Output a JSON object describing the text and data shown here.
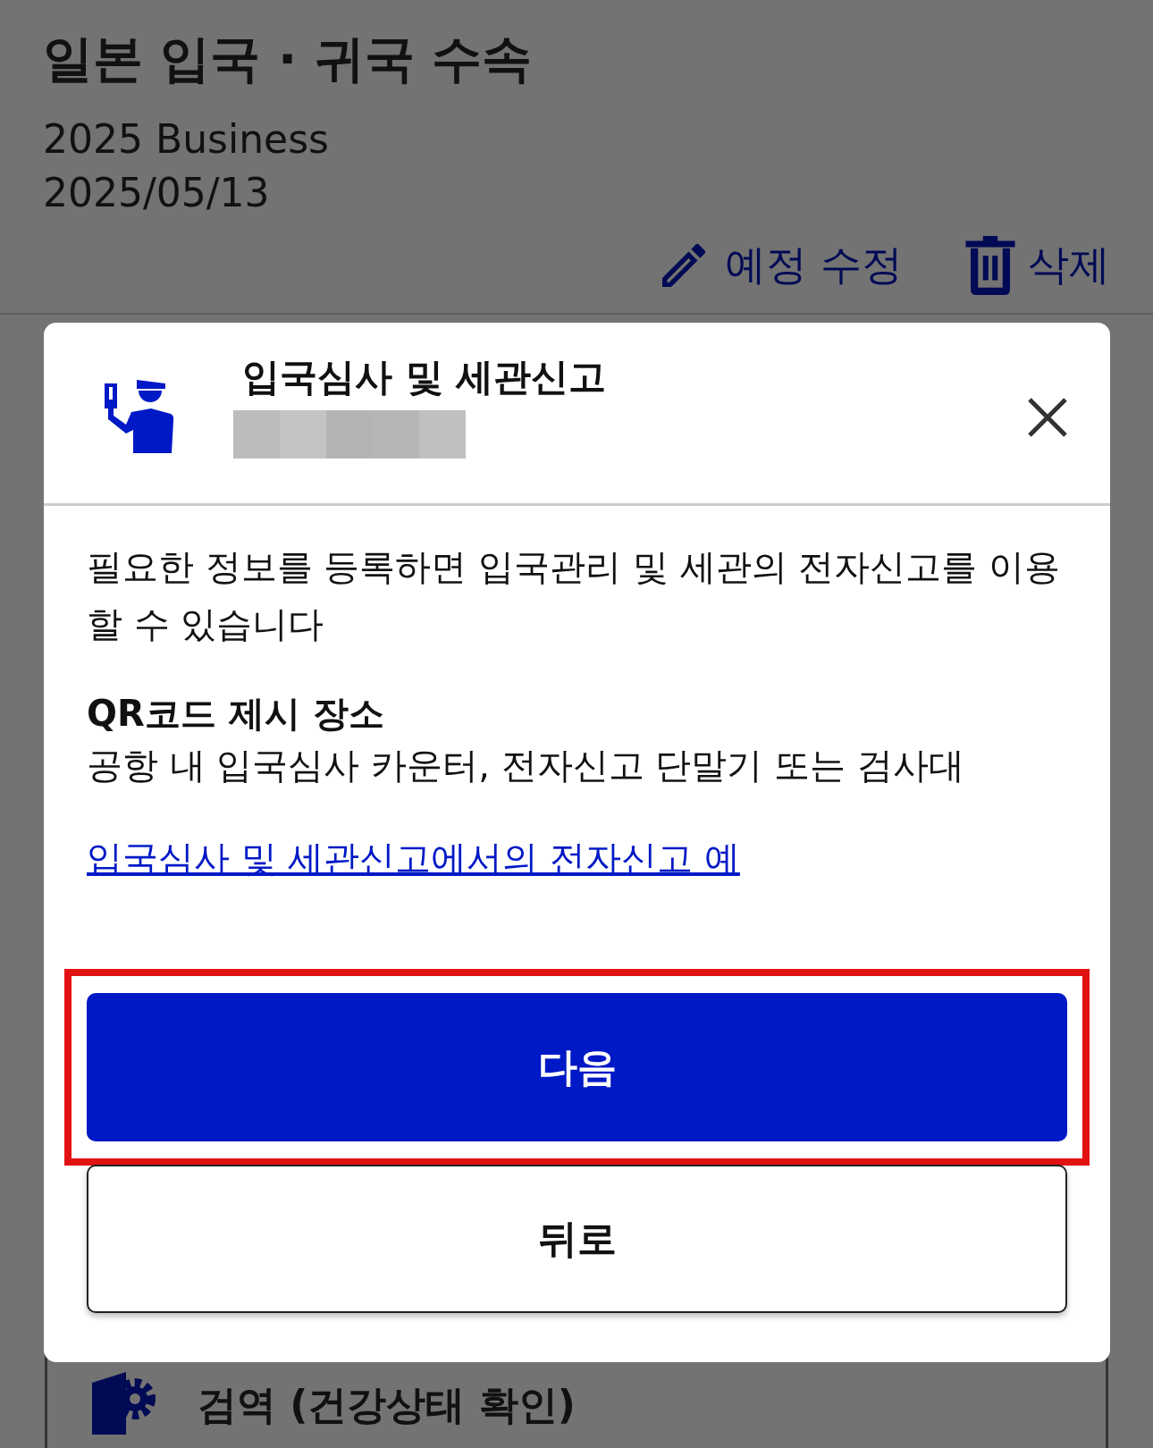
{
  "header": {
    "title": "일본 입국 · 귀국 수속",
    "subtitle": "2025 Business",
    "date": "2025/05/13",
    "actions": [
      {
        "kind": "edit",
        "label": "예정 수정"
      },
      {
        "kind": "delete",
        "label": "삭제"
      }
    ]
  },
  "dialog": {
    "title": "입국심사 및 세관신고",
    "description": "필요한 정보를 등록하면 입국관리 및 세관의 전자신고를 이용할 수 있습니다",
    "section_title": "QR코드 제시 장소",
    "section_text": "공항 내 입국심사 카운터, 전자신고 단말기 또는 검사대",
    "link": "입국심사 및 세관신고에서의 전자신고 예",
    "buttons": [
      {
        "kind": "primary",
        "label": "다음",
        "highlighted": true
      },
      {
        "kind": "secondary",
        "label": "뒤로",
        "highlighted": false
      }
    ]
  },
  "background_items": [
    {
      "title": "검역 (건강상태 확인)"
    }
  ]
}
